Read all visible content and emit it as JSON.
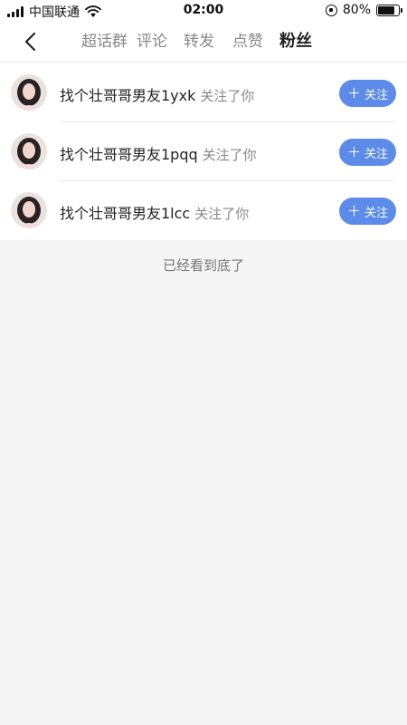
{
  "status_bar": {
    "carrier": "中国联通",
    "time": "02:00",
    "battery": "80%",
    "battery_level": 0.8
  },
  "nav": {
    "tabs": [
      {
        "label": "超话群"
      },
      {
        "label": "评论"
      },
      {
        "label": "转发"
      },
      {
        "label": "点赞"
      },
      {
        "label": "粉丝"
      }
    ],
    "active_tab": "粉丝"
  },
  "followers": [
    {
      "name": "找个壮哥哥男友1yxk",
      "action": "关注了你",
      "button_label": "关注",
      "button_icon": "plus-icon"
    },
    {
      "name": "找个壮哥哥男友1pqq",
      "action": "关注了你",
      "button_label": "关注",
      "button_icon": "plus-icon"
    },
    {
      "name": "找个壮哥哥男友1lcc",
      "action": "关注了你",
      "button_label": "关注",
      "button_icon": "plus-icon"
    }
  ],
  "footer": {
    "end_text": "已经看到底了"
  },
  "colors": {
    "accent": "#5c8bea",
    "background": "#f5f5f5"
  }
}
